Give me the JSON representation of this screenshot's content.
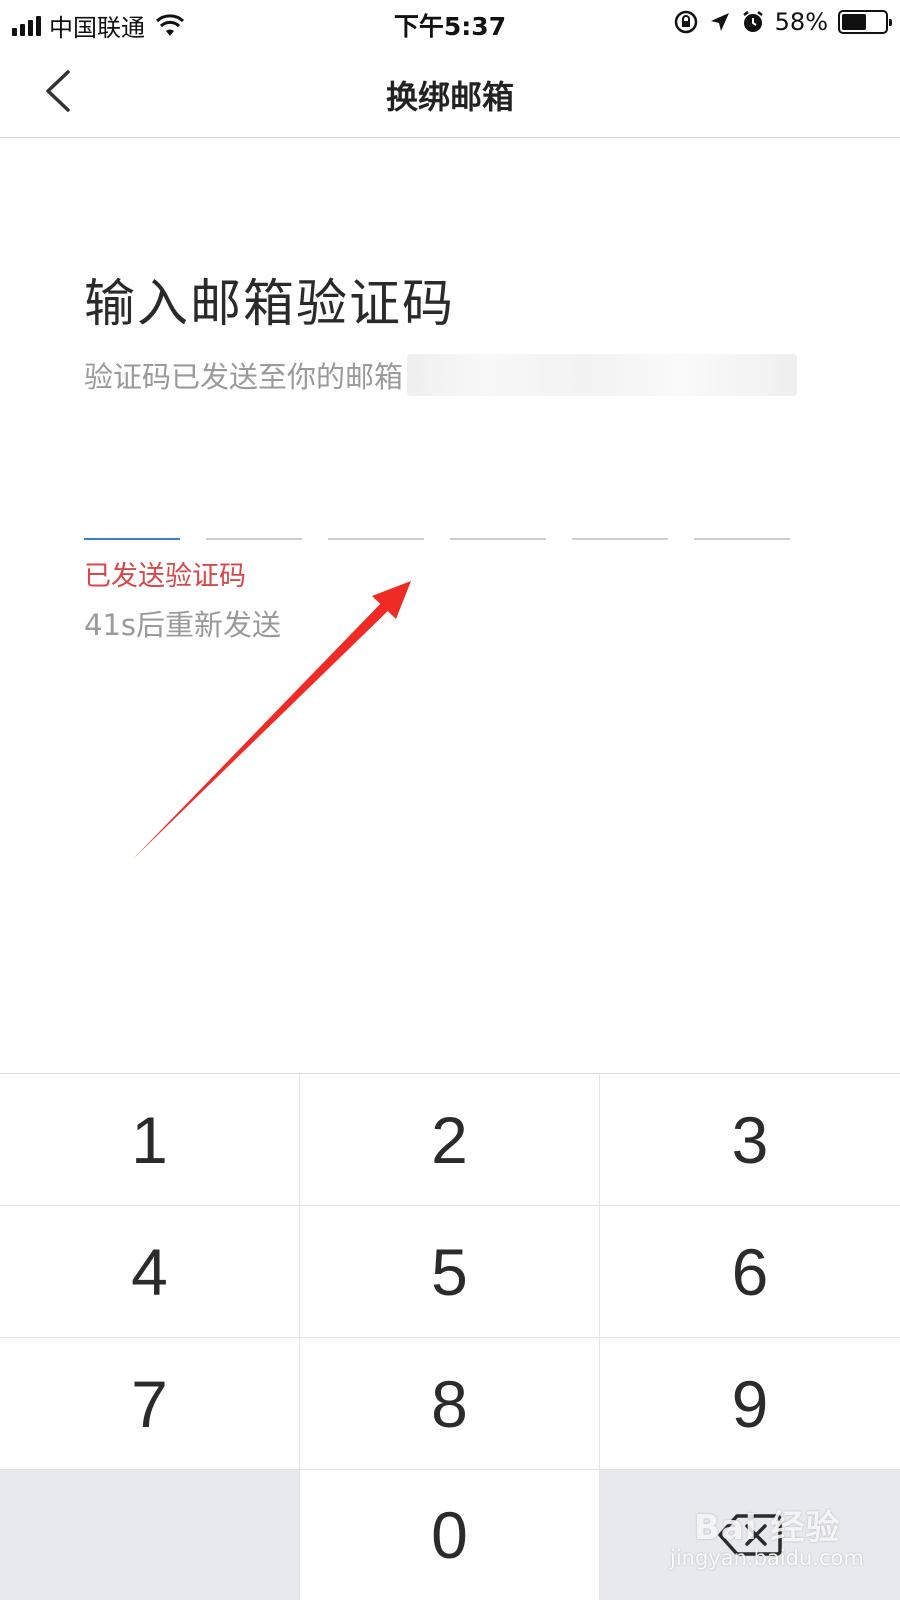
{
  "status_bar": {
    "carrier": "中国联通",
    "time": "下午5:37",
    "battery_percent": "58%",
    "battery_level": 0.58,
    "icons": [
      "signal-icon",
      "wifi-icon",
      "rotation-lock-icon",
      "location-icon",
      "alarm-icon",
      "battery-icon"
    ]
  },
  "nav": {
    "title": "换绑邮箱",
    "back_icon": "chevron-left-icon"
  },
  "content": {
    "heading": "输入邮箱验证码",
    "subtitle": "验证码已发送至你的邮箱",
    "code_length": 6,
    "sent_notice": "已发送验证码",
    "resend_countdown": "41s后重新发送"
  },
  "colors": {
    "active_slot": "#3d7bd9",
    "notice_red": "#d9474a",
    "annotation_arrow": "#f02a25",
    "keypad_gray": "#e7e9ee"
  },
  "keypad": {
    "keys": [
      "1",
      "2",
      "3",
      "4",
      "5",
      "6",
      "7",
      "8",
      "9",
      "",
      "0",
      "delete-icon"
    ]
  },
  "watermark": {
    "brand": "Bai 经验",
    "url": "jingyan.baidu.com"
  }
}
